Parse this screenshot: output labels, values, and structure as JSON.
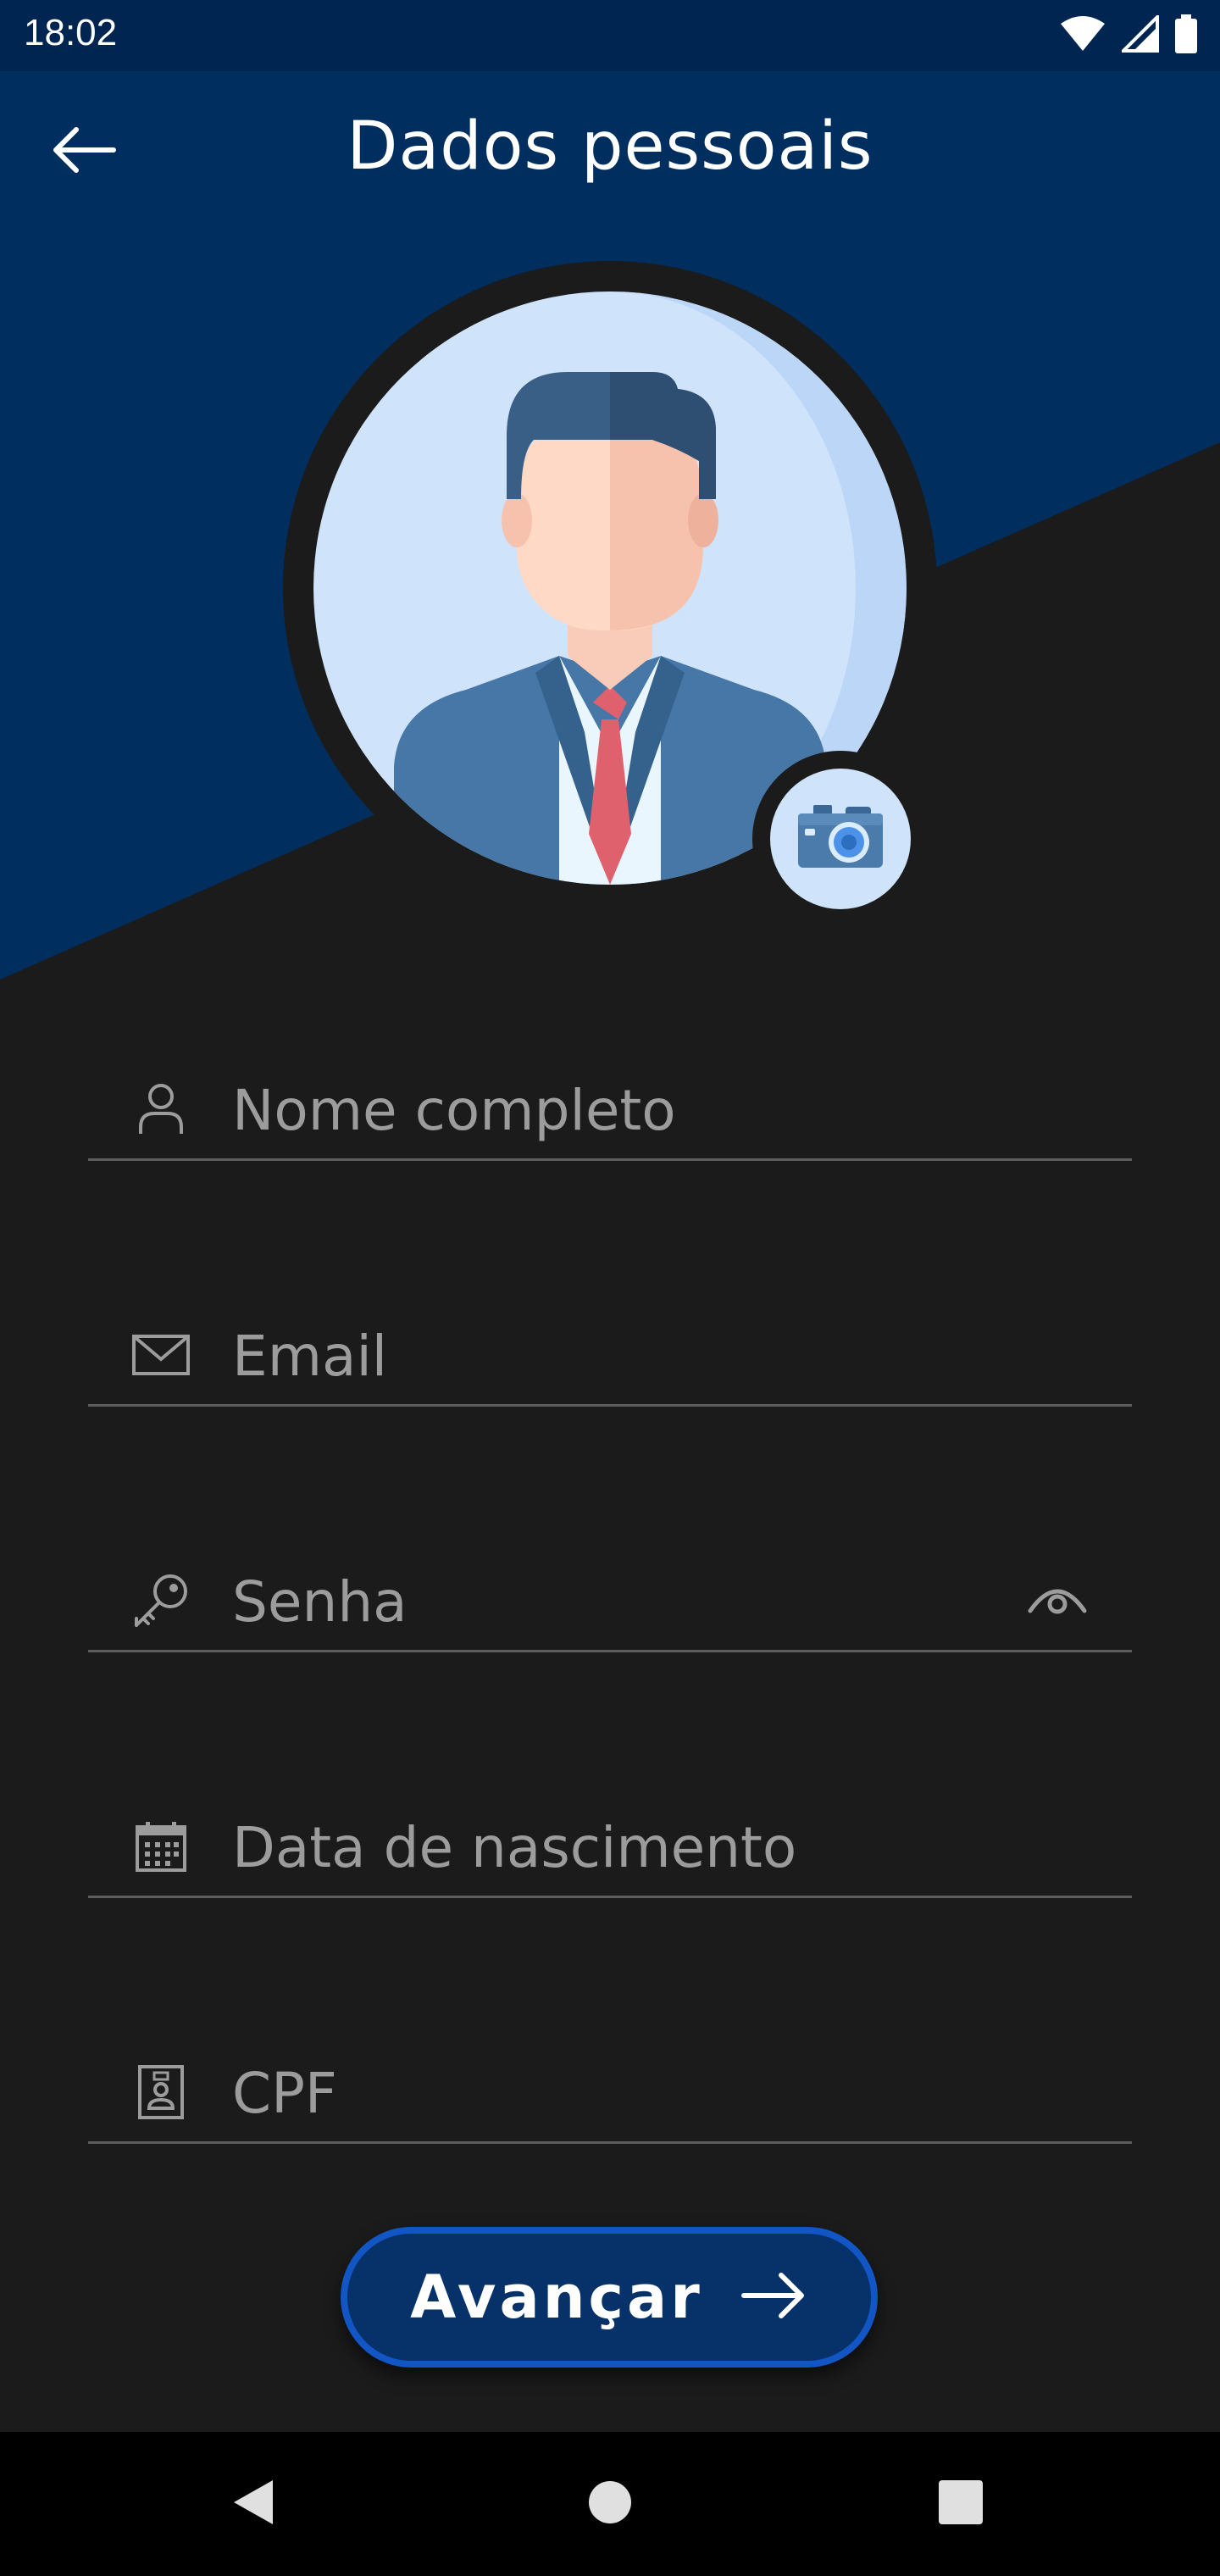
{
  "status_bar": {
    "time": "18:02",
    "icons": [
      "wifi-icon",
      "cellular-signal-icon",
      "battery-icon"
    ]
  },
  "header": {
    "title": "Dados pessoais",
    "back_icon": "arrow-left-icon"
  },
  "profile": {
    "avatar_icon": "businessman-avatar-icon",
    "camera_icon": "camera-icon"
  },
  "form": {
    "fields": [
      {
        "placeholder": "Nome completo",
        "value": "",
        "icon": "person-icon"
      },
      {
        "placeholder": "Email",
        "value": "",
        "icon": "envelope-icon"
      },
      {
        "placeholder": "Senha",
        "value": "",
        "icon": "key-icon",
        "toggle_icon": "eye-icon"
      },
      {
        "placeholder": "Data de nascimento",
        "value": "",
        "icon": "calendar-icon"
      },
      {
        "placeholder": "CPF",
        "value": "",
        "icon": "id-badge-icon"
      }
    ]
  },
  "actions": {
    "next_label": "Avançar",
    "next_icon": "arrow-right-icon"
  },
  "nav_bar": {
    "buttons": [
      "nav-back-icon",
      "nav-home-icon",
      "nav-recents-icon"
    ]
  },
  "colors": {
    "header_blue": "#002F5F",
    "background": "#1B1B1B",
    "button_fill": "#063169",
    "button_border": "#1255C4",
    "divider": "#5D5D5D",
    "placeholder_text": "#9C9C9C"
  }
}
